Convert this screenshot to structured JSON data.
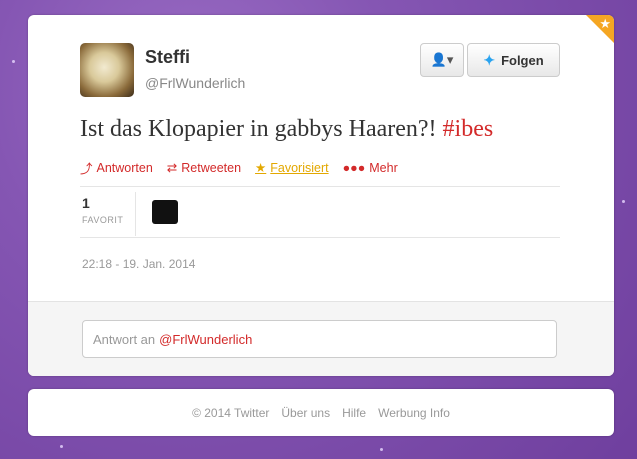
{
  "profile": {
    "name": "Steffi",
    "handle": "@FrlWunderlich",
    "follow_label": "Folgen",
    "user_menu_icon": "user-dropdown-icon"
  },
  "tweet": {
    "text": "Ist das Klopapier in gabbys Haaren?!",
    "hashtag": "#ibes"
  },
  "actions": {
    "reply": "Antworten",
    "retweet": "Retweeten",
    "favorite": "Favorisiert",
    "more": "Mehr"
  },
  "stats": {
    "favorites_count": "1",
    "favorites_label": "FAVORIT"
  },
  "timestamp": "22:18 - 19. Jan. 2014",
  "reply": {
    "prefix": "Antwort an",
    "mention": "@FrlWunderlich"
  },
  "footer": {
    "copyright": "© 2014 Twitter",
    "about": "Über uns",
    "help": "Hilfe",
    "ads": "Werbung Info"
  },
  "colors": {
    "accent_red": "#d32a2a",
    "favorite_gold": "#e3a800",
    "background_purple": "#8556b3"
  }
}
